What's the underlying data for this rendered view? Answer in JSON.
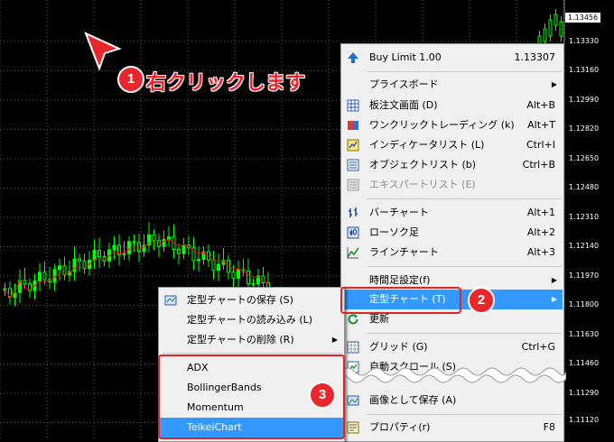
{
  "price_axis": {
    "current": "1.13456",
    "labels": [
      "1.13330",
      "1.13160",
      "1.12990",
      "1.12820",
      "1.12650",
      "1.12480",
      "1.12310",
      "1.12140",
      "1.11970",
      "1.11800",
      "1.11630",
      "1.11460",
      "1.11290",
      "1.11120"
    ]
  },
  "annotation": {
    "step1_number": "1",
    "step1_text": "右クリックします",
    "step2_number": "2",
    "step3_number": "3"
  },
  "context_menu": {
    "buy_limit": {
      "label": "Buy Limit 1.00",
      "value": "1.13307"
    },
    "items": [
      {
        "label": "プライスボード",
        "arrow": "▶"
      },
      {
        "label": "板注文画面 (D)",
        "shortcut": "Alt+B"
      },
      {
        "label": "ワンクリックトレーディング (k)",
        "shortcut": "Alt+T"
      },
      {
        "label": "インディケータリスト (L)",
        "shortcut": "Ctrl+I"
      },
      {
        "label": "オブジェクトリスト (b)",
        "shortcut": "Ctrl+B"
      },
      {
        "label": "エキスパートリスト (E)"
      },
      {
        "label": "バーチャート",
        "shortcut": "Alt+1"
      },
      {
        "label": "ローソク足",
        "shortcut": "Alt+2"
      },
      {
        "label": "ラインチャート",
        "shortcut": "Alt+3"
      },
      {
        "label": "時間足設定(f)",
        "arrow": "▶"
      },
      {
        "label": "定型チャート (T)",
        "arrow": "▶"
      },
      {
        "label": "更新"
      },
      {
        "label": "グリッド (G)",
        "shortcut": "Ctrl+G"
      },
      {
        "label": "自動スクロール (S)"
      },
      {
        "label": "画像として保存 (A)"
      },
      {
        "label": "プロパティ(r)",
        "shortcut": "F8"
      }
    ]
  },
  "template_submenu": {
    "items": [
      {
        "label": "定型チャートの保存 (S)"
      },
      {
        "label": "定型チャートの読み込み (L)"
      },
      {
        "label": "定型チャートの削除 (R)",
        "arrow": "▶"
      },
      {
        "label": "ADX"
      },
      {
        "label": "BollingerBands"
      },
      {
        "label": "Momentum"
      },
      {
        "label": "TeikeiChart"
      }
    ]
  },
  "colors": {
    "candle": "#00ff00",
    "moving_average": "#ff0000",
    "highlight": "#3399ff",
    "annotation": "#e8262b"
  }
}
